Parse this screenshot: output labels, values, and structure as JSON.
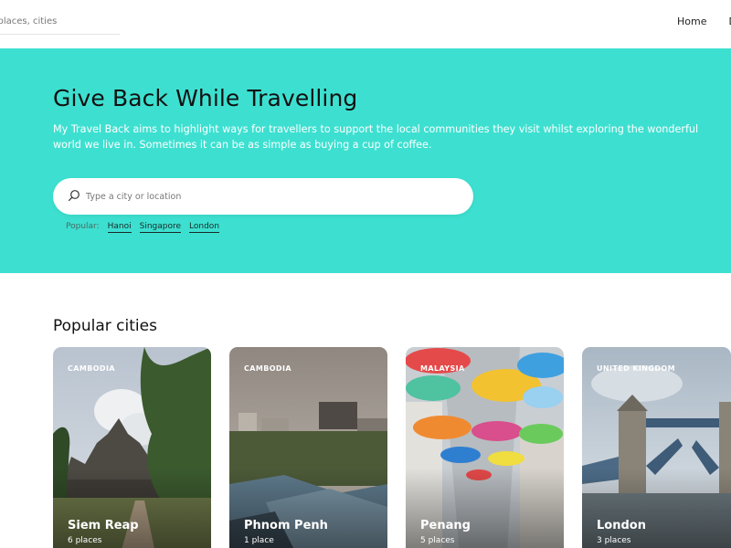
{
  "colors": {
    "hero_bg": "#3de0d0",
    "hero_text": "#ffffff"
  },
  "header": {
    "search_placeholder": "h places, cities",
    "nav": [
      "Home",
      "D"
    ]
  },
  "hero": {
    "title": "Give Back While Travelling",
    "description": "My Travel Back aims to highlight ways for travellers to support the local communities they visit whilst exploring the wonderful world we live in. Sometimes it can be as simple as buying a cup of coffee.",
    "search_placeholder": "Type a city or location",
    "search_icon": "search-icon",
    "popular_label": "Popular:",
    "popular_links": [
      "Hanoi",
      "Singapore",
      "London"
    ]
  },
  "popular_cities": {
    "title": "Popular cities",
    "cards": [
      {
        "country": "CAMBODIA",
        "city": "Siem Reap",
        "count": "6 places"
      },
      {
        "country": "CAMBODIA",
        "city": "Phnom Penh",
        "count": "1 place"
      },
      {
        "country": "MALAYSIA",
        "city": "Penang",
        "count": "5 places"
      },
      {
        "country": "UNITED KINGDOM",
        "city": "London",
        "count": "3 places"
      }
    ]
  }
}
